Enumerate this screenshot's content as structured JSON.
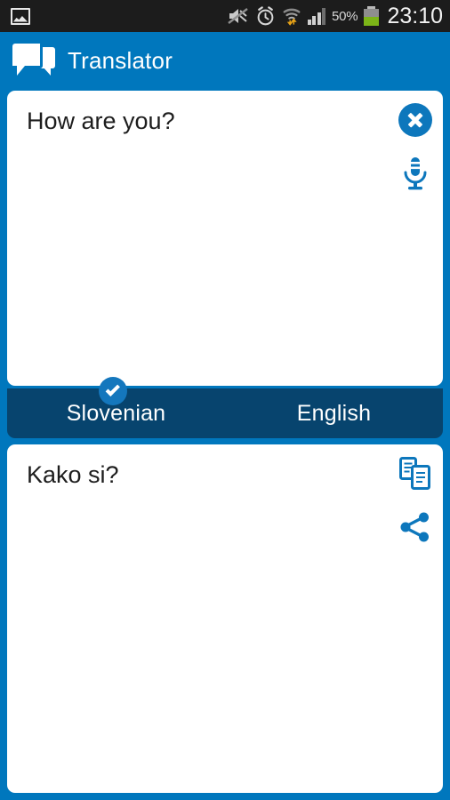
{
  "statusbar": {
    "gallery_icon": "gallery-icon",
    "mute_icon": "volume-mute-icon",
    "alarm_icon": "alarm-clock-icon",
    "wifi_icon": "wifi-transfer-icon",
    "signal_icon": "cellular-signal-icon",
    "battery_percent": "50%",
    "battery_icon": "battery-icon",
    "clock": "23:10"
  },
  "appbar": {
    "logo_icon": "speech-bubbles-icon",
    "title": "Translator"
  },
  "source_card": {
    "text": "How are you?",
    "clear_icon": "close-circle-icon",
    "mic_icon": "microphone-icon"
  },
  "language_bar": {
    "source_language": "Slovenian",
    "target_language": "English",
    "selected": "Slovenian",
    "check_icon": "check-circle-icon"
  },
  "target_card": {
    "text": "Kako si?",
    "copy_icon": "copy-icon",
    "share_icon": "share-icon"
  },
  "colors": {
    "background_blue": "#0077bd",
    "lang_bar_navy": "#07446e",
    "accent_blue": "#0d77bc",
    "card_white": "#ffffff",
    "status_bar": "#1c1c1c",
    "battery_green": "#7cb518",
    "text_dark": "#1d1d1d"
  }
}
